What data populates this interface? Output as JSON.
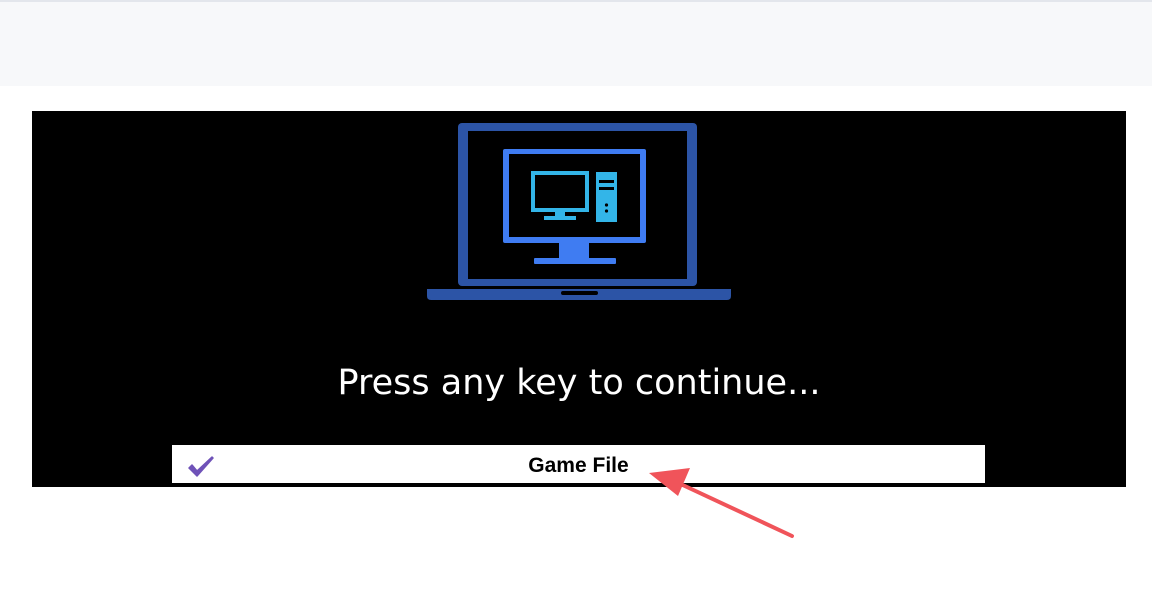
{
  "screen": {
    "prompt": "Press any key to continue...",
    "loaded_file": {
      "label": "Game File",
      "status_icon": "checkmark-icon"
    }
  },
  "illustration": {
    "name": "laptop-with-computer-icon",
    "colors": {
      "laptop": "#2c54a6",
      "monitor_frame": "#3f7cf2",
      "inner_screen": "#33b5e8",
      "background": "#000000"
    }
  },
  "annotation": {
    "type": "arrow",
    "color": "#f0545a",
    "points_to": "Game File"
  },
  "colors": {
    "topbar": "#f7f8fa",
    "check": "#6f52b8"
  }
}
